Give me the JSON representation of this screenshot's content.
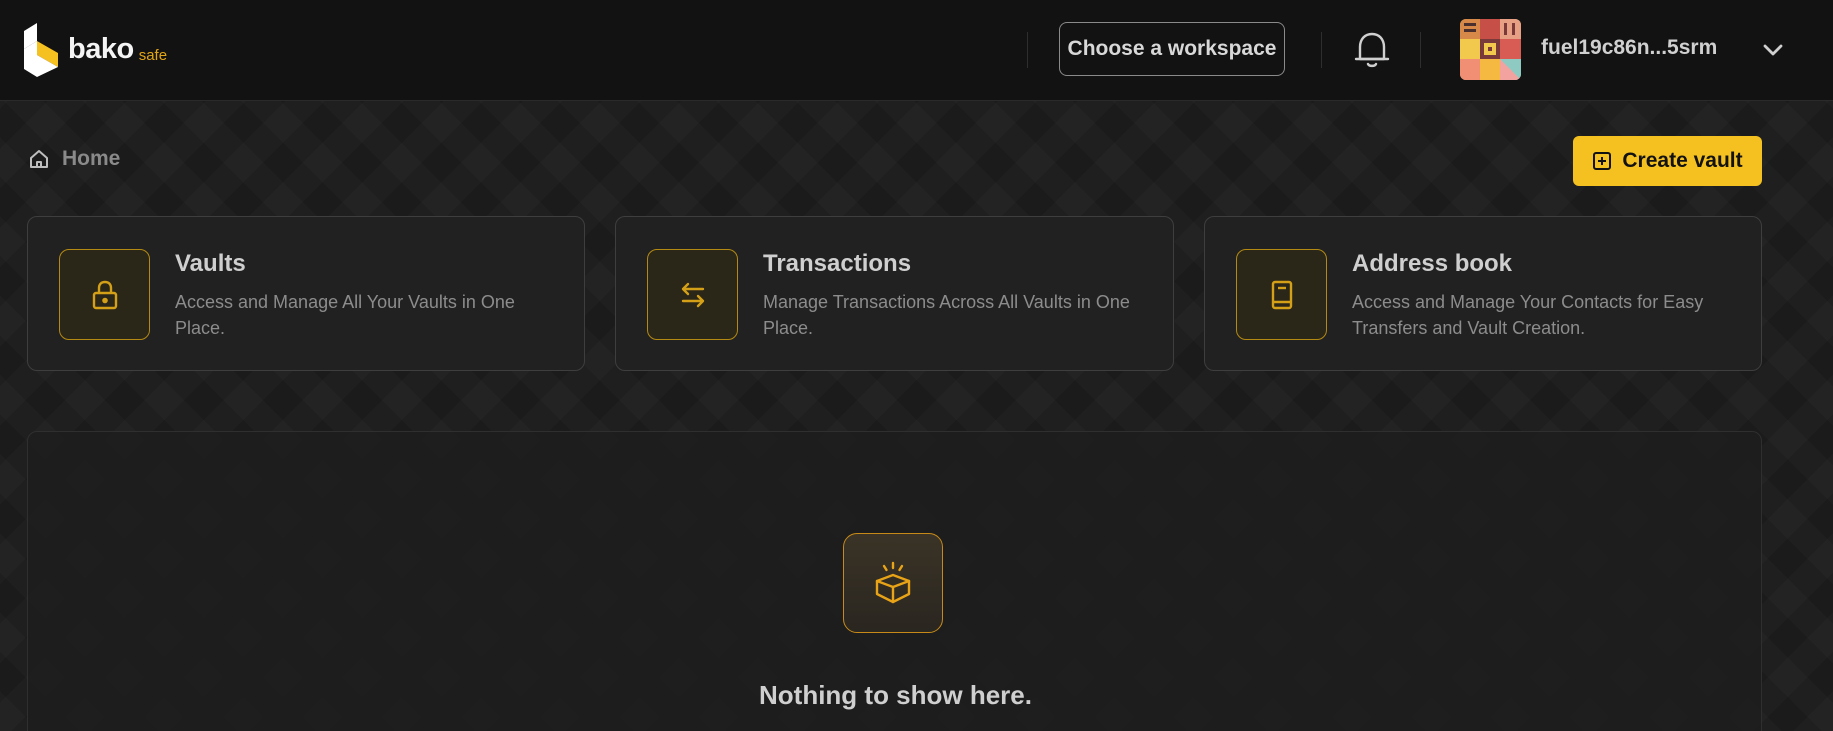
{
  "header": {
    "logo_text": "bako",
    "logo_subtext": "safe",
    "workspace_button": "Choose a workspace",
    "user_address": "fuel19c86n...5srm"
  },
  "breadcrumb": {
    "home_label": "Home"
  },
  "actions": {
    "create_vault": "Create vault"
  },
  "cards": [
    {
      "title": "Vaults",
      "description": "Access and Manage All Your Vaults in One Place.",
      "icon": "lock-icon"
    },
    {
      "title": "Transactions",
      "description": "Manage Transactions Across All Vaults in One Place.",
      "icon": "arrows-swap-icon"
    },
    {
      "title": "Address book",
      "description": "Access and Manage Your Contacts for Easy Transfers and Vault Creation.",
      "icon": "book-icon"
    }
  ],
  "empty_state": {
    "message": "Nothing to show here.",
    "icon": "open-box-icon"
  },
  "colors": {
    "accent": "#f5c120",
    "icon_border": "#b48a12",
    "background": "#161616"
  }
}
